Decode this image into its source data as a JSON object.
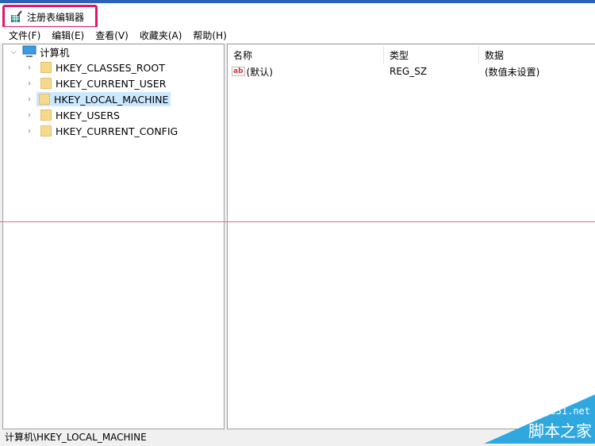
{
  "window": {
    "title": "注册表编辑器"
  },
  "menu": [
    "文件(F)",
    "编辑(E)",
    "查看(V)",
    "收藏夹(A)",
    "帮助(H)"
  ],
  "tree": {
    "root": "计算机",
    "children": [
      "HKEY_CLASSES_ROOT",
      "HKEY_CURRENT_USER",
      "HKEY_LOCAL_MACHINE",
      "HKEY_USERS",
      "HKEY_CURRENT_CONFIG"
    ],
    "selected": "HKEY_LOCAL_MACHINE"
  },
  "list": {
    "columns": [
      "名称",
      "类型",
      "数据"
    ],
    "rows": [
      {
        "name": "(默认)",
        "type": "REG_SZ",
        "data": "(数值未设置)"
      }
    ]
  },
  "status": "计算机\\HKEY_LOCAL_MACHINE",
  "watermark": {
    "site": "jb51.net",
    "name": "脚本之家"
  }
}
